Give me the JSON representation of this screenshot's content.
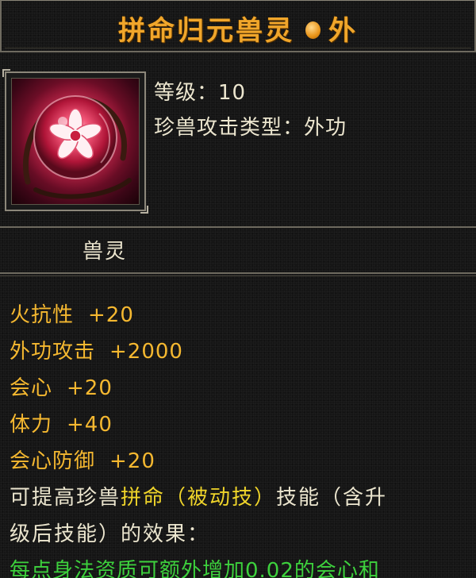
{
  "title": {
    "name": "拼命归元兽灵",
    "suffix": "外",
    "color": "#f0a62b"
  },
  "icon": {
    "name": "flower-orb-icon",
    "color": "#c9264a"
  },
  "info": {
    "level_label": "等级：",
    "level_value": "10",
    "type_label": "珍兽攻击类型：",
    "type_value": "外功"
  },
  "item_name": "兽灵",
  "stats": [
    {
      "label": "火抗性",
      "value": "+20"
    },
    {
      "label": "外功攻击",
      "value": "+2000"
    },
    {
      "label": "会心",
      "value": "+20"
    },
    {
      "label": "体力",
      "value": "+40"
    },
    {
      "label": "会心防御",
      "value": "+20"
    }
  ],
  "description": {
    "line1_prefix": "可提高珍兽",
    "line1_highlight": "拼命（被动技）",
    "line1_suffix": "技能（含升",
    "line2": "级后技能）的效果：",
    "line3": "每点身法资质可额外增加0.02的会心和"
  },
  "colors": {
    "stat_text": "#f5b830",
    "highlight": "#f0d52a",
    "effect_text": "#3dd13d",
    "body_text": "#ece6cf"
  }
}
